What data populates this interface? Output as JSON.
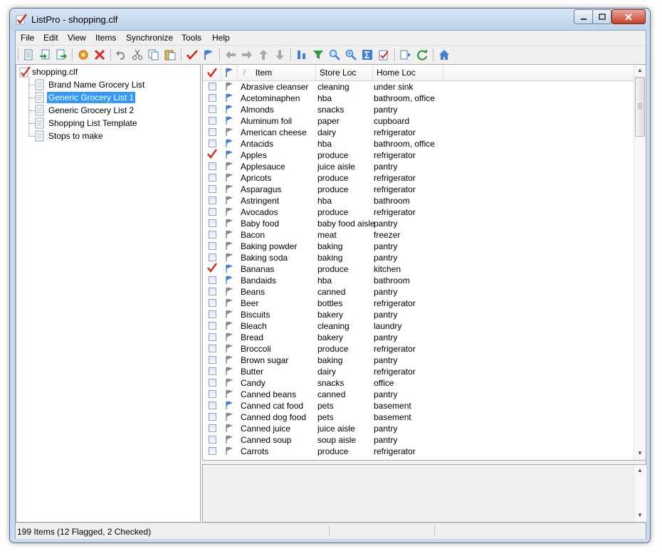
{
  "window": {
    "title": "ListPro - shopping.clf"
  },
  "menu": [
    "File",
    "Edit",
    "View",
    "Items",
    "Synchronize",
    "Tools",
    "Help"
  ],
  "toolbar": [
    "new-list-icon",
    "import-icon",
    "export-icon",
    "settings-gear-icon",
    "delete-icon",
    "undo-icon",
    "cut-icon",
    "copy-icon",
    "paste-icon",
    "check-icon",
    "flag-icon",
    "back-arrow-icon",
    "forward-arrow-icon",
    "up-arrow-icon",
    "down-arrow-icon",
    "sort-icon",
    "filter-icon",
    "find-icon",
    "find-next-icon",
    "sum-icon",
    "checklist-icon",
    "sync-out-icon",
    "refresh-icon",
    "home-icon"
  ],
  "tree": {
    "root": "shopping.clf",
    "items": [
      "Brand Name Grocery List",
      "Generic Grocery List 1",
      "Generic Grocery List 2",
      "Shopping List Template",
      "Stops to make"
    ],
    "selected_index": 1
  },
  "columns": {
    "sort_indicator": "/",
    "item": "Item",
    "store": "Store Loc",
    "home": "Home Loc"
  },
  "rows": [
    {
      "item": "Abrasive cleanser",
      "store": "cleaning",
      "home": "under sink",
      "checked": false,
      "flagged": false
    },
    {
      "item": "Acetominaphen",
      "store": "hba",
      "home": "bathroom, office",
      "checked": false,
      "flagged": true
    },
    {
      "item": "Almonds",
      "store": "snacks",
      "home": "pantry",
      "checked": false,
      "flagged": true
    },
    {
      "item": "Aluminum foil",
      "store": "paper",
      "home": "cupboard",
      "checked": false,
      "flagged": true
    },
    {
      "item": "American cheese",
      "store": "dairy",
      "home": "refrigerator",
      "checked": false,
      "flagged": false
    },
    {
      "item": "Antacids",
      "store": "hba",
      "home": "bathroom, office",
      "checked": false,
      "flagged": true
    },
    {
      "item": "Apples",
      "store": "produce",
      "home": "refrigerator",
      "checked": true,
      "flagged": true
    },
    {
      "item": "Applesauce",
      "store": "juice aisle",
      "home": "pantry",
      "checked": false,
      "flagged": false
    },
    {
      "item": "Apricots",
      "store": "produce",
      "home": "refrigerator",
      "checked": false,
      "flagged": false
    },
    {
      "item": "Asparagus",
      "store": "produce",
      "home": "refrigerator",
      "checked": false,
      "flagged": false
    },
    {
      "item": "Astringent",
      "store": "hba",
      "home": "bathroom",
      "checked": false,
      "flagged": false
    },
    {
      "item": "Avocados",
      "store": "produce",
      "home": "refrigerator",
      "checked": false,
      "flagged": false
    },
    {
      "item": "Baby food",
      "store": "baby food aisle",
      "home": "pantry",
      "checked": false,
      "flagged": false
    },
    {
      "item": "Bacon",
      "store": "meat",
      "home": "freezer",
      "checked": false,
      "flagged": false
    },
    {
      "item": "Baking powder",
      "store": "baking",
      "home": "pantry",
      "checked": false,
      "flagged": false
    },
    {
      "item": "Baking soda",
      "store": "baking",
      "home": "pantry",
      "checked": false,
      "flagged": false
    },
    {
      "item": "Bananas",
      "store": "produce",
      "home": "kitchen",
      "checked": true,
      "flagged": true
    },
    {
      "item": "Bandaids",
      "store": "hba",
      "home": "bathroom",
      "checked": false,
      "flagged": true
    },
    {
      "item": "Beans",
      "store": "canned",
      "home": "pantry",
      "checked": false,
      "flagged": false
    },
    {
      "item": "Beer",
      "store": "bottles",
      "home": "refrigerator",
      "checked": false,
      "flagged": false
    },
    {
      "item": "Biscuits",
      "store": "bakery",
      "home": "pantry",
      "checked": false,
      "flagged": false
    },
    {
      "item": "Bleach",
      "store": "cleaning",
      "home": "laundry",
      "checked": false,
      "flagged": false
    },
    {
      "item": "Bread",
      "store": "bakery",
      "home": "pantry",
      "checked": false,
      "flagged": false
    },
    {
      "item": "Broccoli",
      "store": "produce",
      "home": "refrigerator",
      "checked": false,
      "flagged": false
    },
    {
      "item": "Brown sugar",
      "store": "baking",
      "home": "pantry",
      "checked": false,
      "flagged": false
    },
    {
      "item": "Butter",
      "store": "dairy",
      "home": "refrigerator",
      "checked": false,
      "flagged": false
    },
    {
      "item": "Candy",
      "store": "snacks",
      "home": "office",
      "checked": false,
      "flagged": false
    },
    {
      "item": "Canned beans",
      "store": "canned",
      "home": "pantry",
      "checked": false,
      "flagged": false
    },
    {
      "item": "Canned cat food",
      "store": "pets",
      "home": "basement",
      "checked": false,
      "flagged": true
    },
    {
      "item": "Canned dog food",
      "store": "pets",
      "home": "basement",
      "checked": false,
      "flagged": false
    },
    {
      "item": "Canned juice",
      "store": "juice aisle",
      "home": "pantry",
      "checked": false,
      "flagged": false
    },
    {
      "item": "Canned soup",
      "store": "soup aisle",
      "home": "pantry",
      "checked": false,
      "flagged": false
    },
    {
      "item": "Carrots",
      "store": "produce",
      "home": "refrigerator",
      "checked": false,
      "flagged": false
    }
  ],
  "status": {
    "summary": "199 Items (12 Flagged, 2 Checked)"
  },
  "colors": {
    "selection": "#3399ff",
    "check": "#d42b1e",
    "flag_active": "#3f7fd6",
    "flag_inactive": "#8a8a8a"
  }
}
